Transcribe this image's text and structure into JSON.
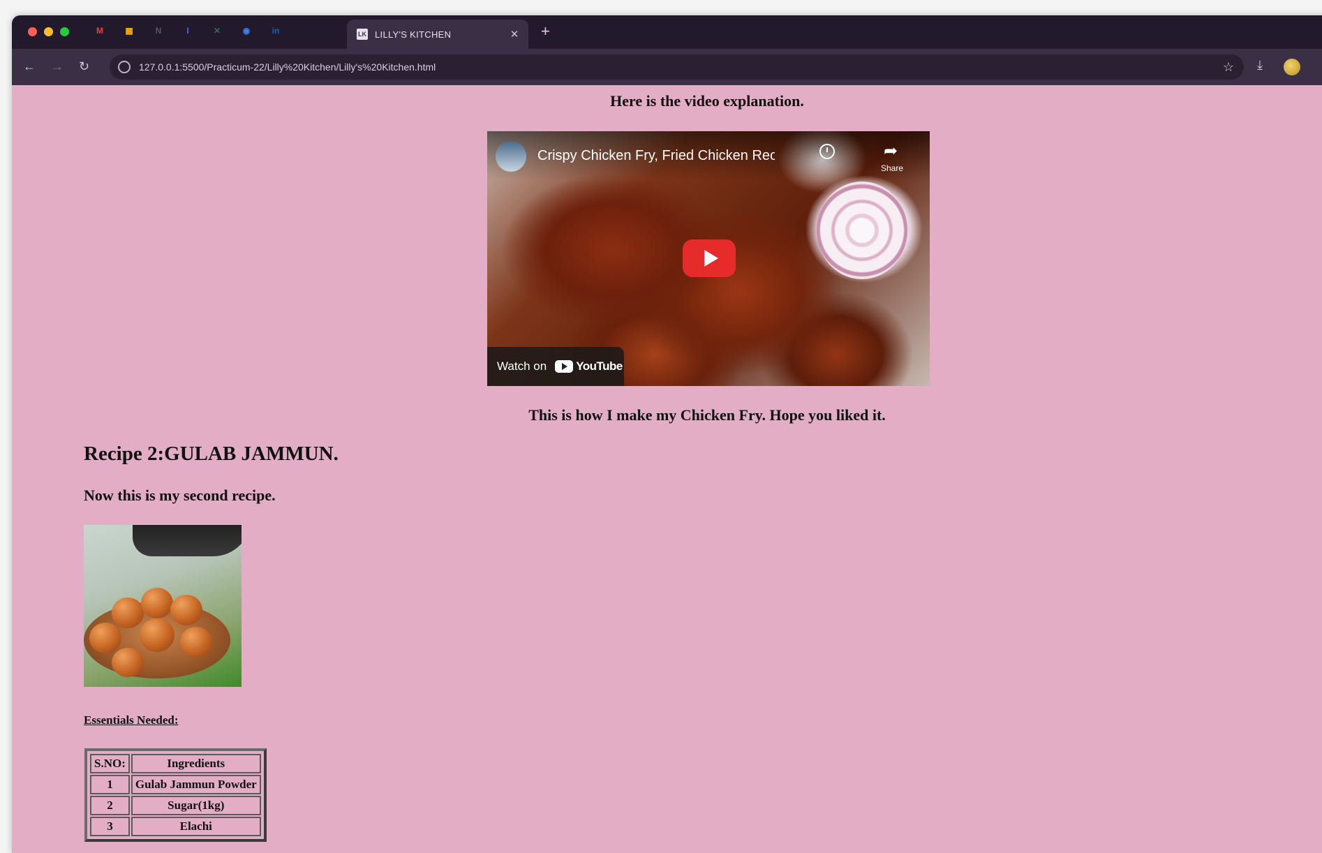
{
  "browser": {
    "tab_title": "LILLY'S KITCHEN",
    "tab_favicon_text": "LK",
    "url": "127.0.0.1:5500/Practicum-22/Lilly%20Kitchen/Lilly's%20Kitchen.html",
    "pinned_tabs": [
      {
        "icon": "gmail-icon",
        "glyph": "M",
        "color": "#ea4335"
      },
      {
        "icon": "sheets-icon",
        "glyph": "▦",
        "color": "#f4b400"
      },
      {
        "icon": "notion-icon",
        "glyph": "N",
        "color": "#5a5a5a"
      },
      {
        "icon": "text-icon",
        "glyph": "I",
        "color": "#4a6ee0"
      },
      {
        "icon": "app-icon",
        "glyph": "✕",
        "color": "#2f6f4f"
      },
      {
        "icon": "globe-icon",
        "glyph": "◉",
        "color": "#3b82f6"
      },
      {
        "icon": "linkedin-icon",
        "glyph": "in",
        "color": "#0a66c2"
      }
    ]
  },
  "page": {
    "video_intro": "Here is the video explanation.",
    "video": {
      "title": "Crispy Chicken Fry, Fried Chicken Rec",
      "share_label": "Share",
      "watch_on": "Watch on",
      "youtube": "YouTube"
    },
    "video_caption": "This is how I make my Chicken Fry. Hope you liked it.",
    "recipe2_heading": "Recipe 2:GULAB JAMMUN.",
    "recipe2_sub": "Now this is my second recipe.",
    "essentials_label": "Essentials Needed:",
    "table": {
      "headers": [
        "S.NO:",
        "Ingredients"
      ],
      "rows": [
        [
          "1",
          "Gulab Jammun Powder"
        ],
        [
          "2",
          "Sugar(1kg)"
        ],
        [
          "3",
          "Elachi"
        ]
      ]
    }
  }
}
